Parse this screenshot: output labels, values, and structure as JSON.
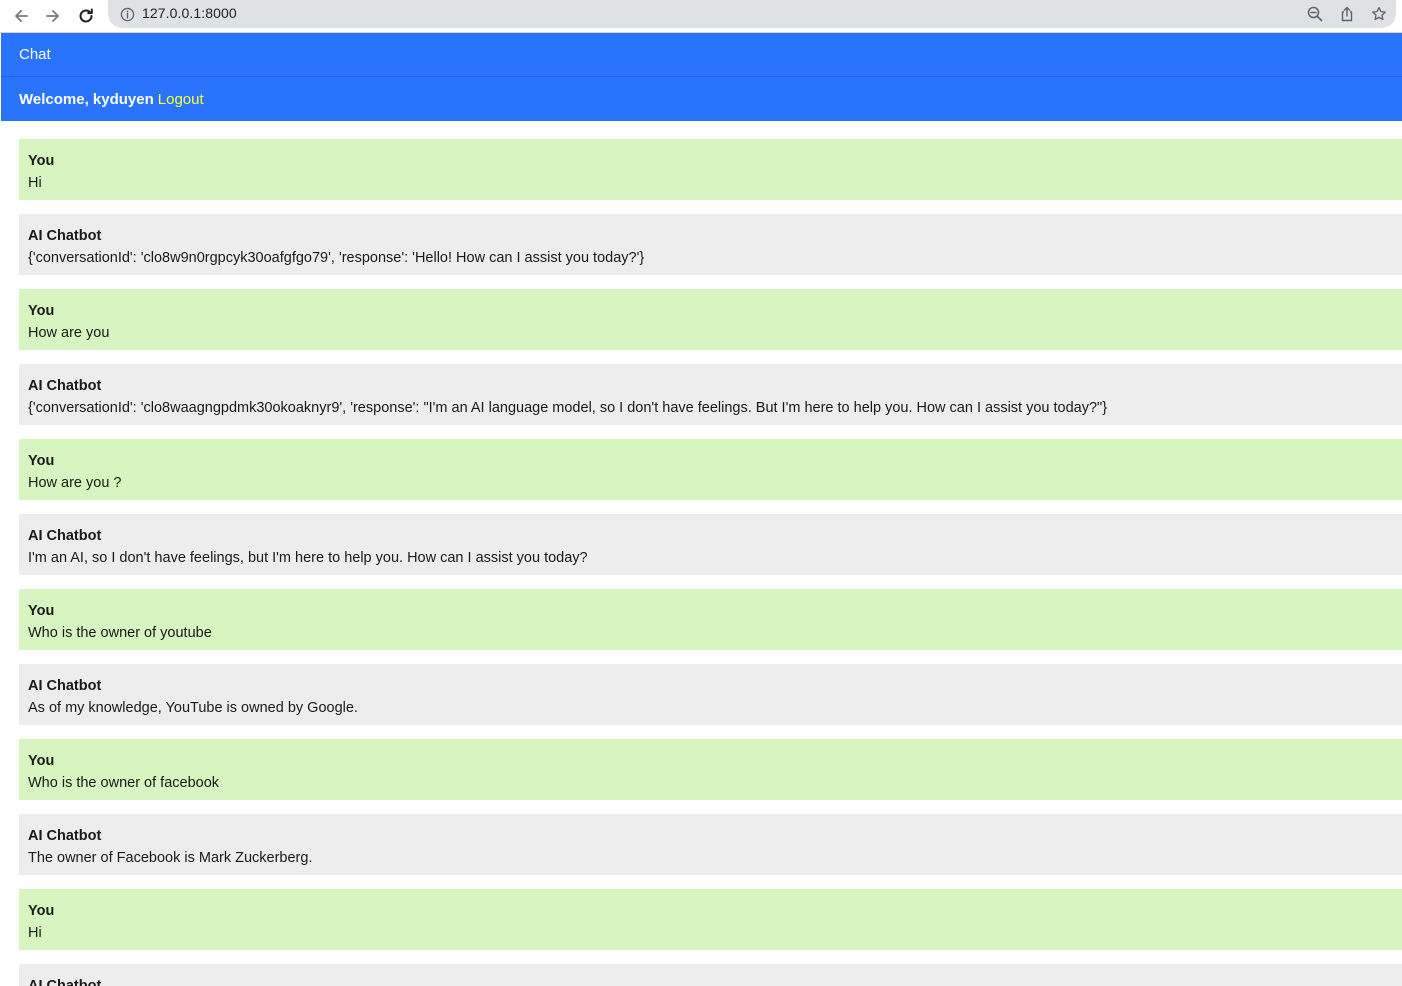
{
  "browser": {
    "url": "127.0.0.1:8000"
  },
  "header": {
    "brand": "Chat",
    "welcome": "Welcome, kyduyen",
    "logout": "Logout"
  },
  "messages": [
    {
      "role": "user",
      "sender": "You",
      "text": "Hi"
    },
    {
      "role": "bot",
      "sender": "AI Chatbot",
      "text": "{'conversationId': 'clo8w9n0rgpcyk30oafgfgo79', 'response': 'Hello! How can I assist you today?'}"
    },
    {
      "role": "user",
      "sender": "You",
      "text": "How are you"
    },
    {
      "role": "bot",
      "sender": "AI Chatbot",
      "text": "{'conversationId': 'clo8waagngpdmk30okoaknyr9', 'response': \"I'm an AI language model, so I don't have feelings. But I'm here to help you. How can I assist you today?\"}"
    },
    {
      "role": "user",
      "sender": "You",
      "text": "How are you ?"
    },
    {
      "role": "bot",
      "sender": "AI Chatbot",
      "text": "I'm an AI, so I don't have feelings, but I'm here to help you. How can I assist you today?"
    },
    {
      "role": "user",
      "sender": "You",
      "text": "Who is the owner of youtube"
    },
    {
      "role": "bot",
      "sender": "AI Chatbot",
      "text": "As of my knowledge, YouTube is owned by Google."
    },
    {
      "role": "user",
      "sender": "You",
      "text": "Who is the owner of facebook"
    },
    {
      "role": "bot",
      "sender": "AI Chatbot",
      "text": "The owner of Facebook is Mark Zuckerberg."
    },
    {
      "role": "user",
      "sender": "You",
      "text": "Hi"
    },
    {
      "role": "bot",
      "sender": "AI Chatbot",
      "text": ""
    }
  ],
  "colors": {
    "header_bg": "#2a73ff",
    "logout": "#ffff3b",
    "user_bubble": "#d7f5c0",
    "bot_bubble": "#ededed"
  },
  "icons": [
    "back-arrow-icon",
    "forward-arrow-icon",
    "reload-icon",
    "info-icon",
    "zoom-out-icon",
    "share-icon",
    "star-icon"
  ]
}
